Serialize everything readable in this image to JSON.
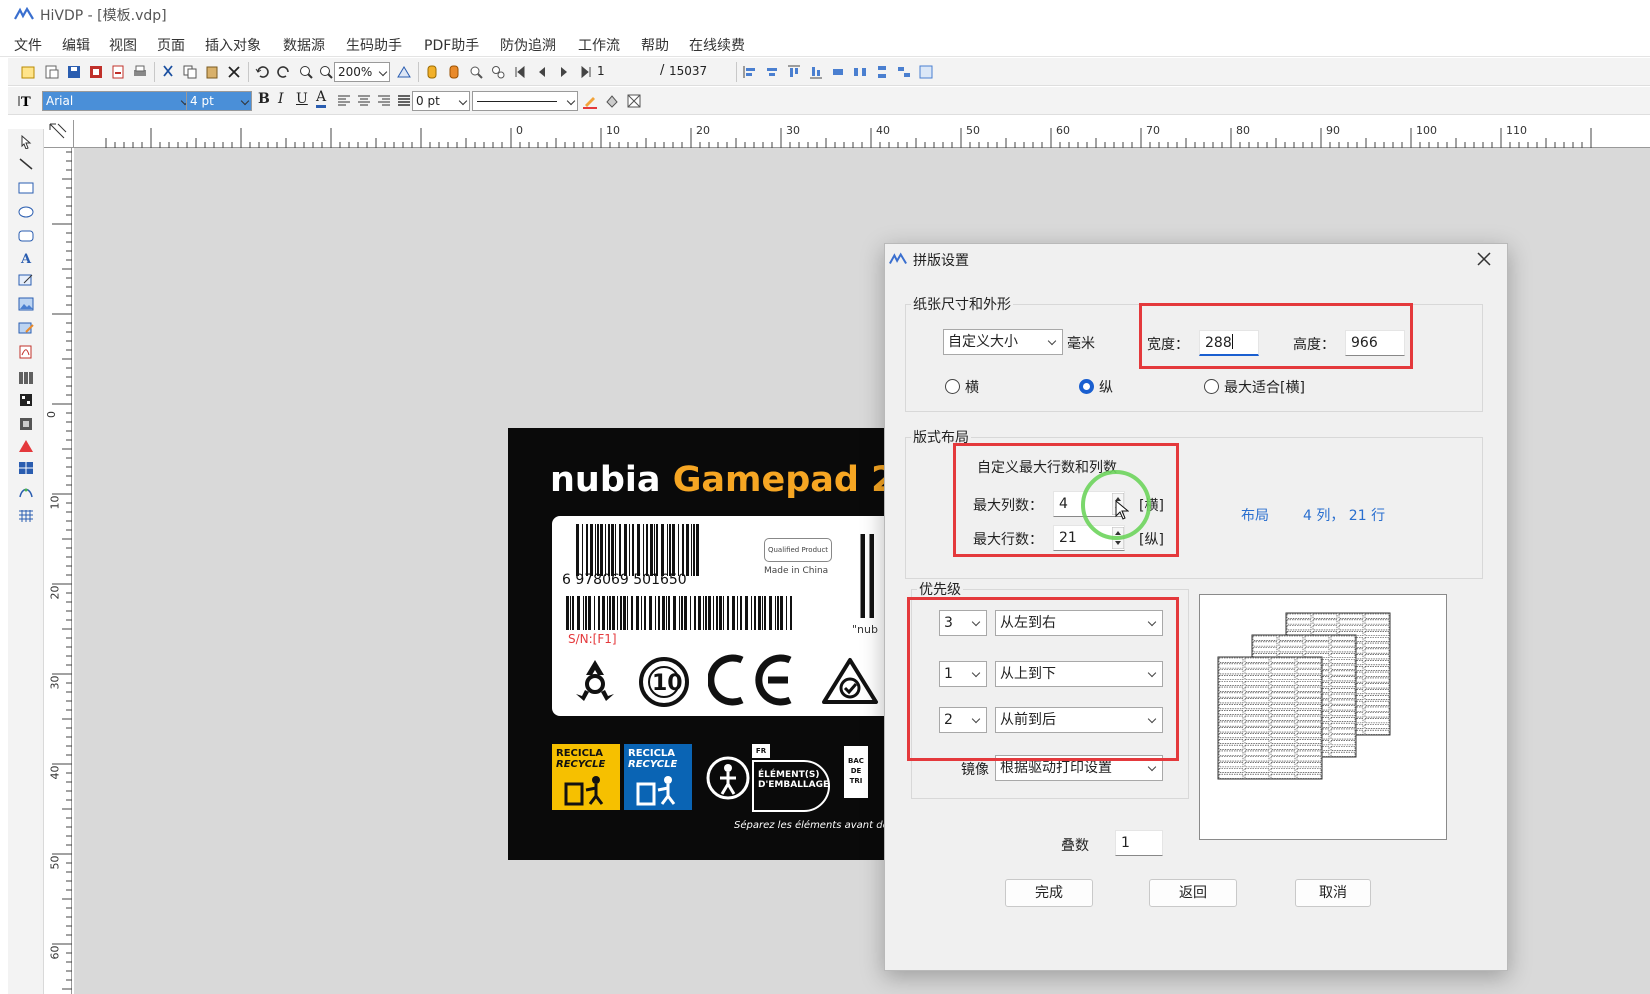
{
  "window": {
    "title": "HiVDP - [模板.vdp]"
  },
  "menu": [
    "文件",
    "编辑",
    "视图",
    "页面",
    "插入对象",
    "数据源",
    "生码助手",
    "PDF助手",
    "防伪追溯",
    "工作流",
    "帮助",
    "在线续费"
  ],
  "toolbar1": {
    "zoom": "200%",
    "page_current": "1",
    "page_separator": "/",
    "page_total": "15037"
  },
  "toolbar2": {
    "font": "Arial",
    "font_size": "4 pt",
    "line_width": "0 pt"
  },
  "ruler": {
    "h_marks": [
      "0",
      "10",
      "20",
      "30",
      "40",
      "50",
      "60",
      "70",
      "80",
      "90",
      "100",
      "110"
    ],
    "v_marks": [
      "0",
      "10",
      "20",
      "30",
      "40",
      "50",
      "60"
    ]
  },
  "label": {
    "brand": "nubia",
    "product": "Gamepad 2",
    "barcode_digits": "6 978069 501650",
    "made_in": "Made in China",
    "qualified": "Qualified Product",
    "sn": "S/N:[F1]",
    "recycle1": [
      "RECICLA",
      "RECYCLE"
    ],
    "recycle2": [
      "RECICLA",
      "RECYCLE"
    ],
    "fr": "FR",
    "element_text": [
      "ÉLÉMENT(S)",
      "D'EMBALLAGE"
    ],
    "bac": [
      "BAC",
      "DE",
      "TRI"
    ],
    "separez": "Séparez les éléments avant de",
    "qr_partial": "\"nub",
    "ten": "10"
  },
  "dialog": {
    "title": "拼版设置",
    "paper_group": "纸张尺寸和外形",
    "paper_size": "自定义大小",
    "unit": "毫米",
    "width_label": "宽度：",
    "width_value": "288",
    "height_label": "高度：",
    "height_value": "966",
    "orient": [
      {
        "label": "横",
        "checked": false
      },
      {
        "label": "纵",
        "checked": true
      },
      {
        "label": "最大适合[横]",
        "checked": false
      }
    ],
    "layout_group": "版式布局",
    "custom_max": "自定义最大行数和列数",
    "max_cols_label": "最大列数：",
    "max_cols": "4",
    "cols_unit": "[横]",
    "max_rows_label": "最大行数：",
    "max_rows": "21",
    "rows_unit": "[纵]",
    "layout_label": "布局",
    "layout_summary": "4 列，  21 行",
    "priority_group": "优先级",
    "priorities": [
      {
        "num": "3",
        "dir": "从左到右"
      },
      {
        "num": "1",
        "dir": "从上到下"
      },
      {
        "num": "2",
        "dir": "从前到后"
      }
    ],
    "mirror_label": "镜像",
    "mirror_value": "根据驱动打印设置",
    "stack_label": "叠数",
    "stack_value": "1",
    "buttons": {
      "done": "完成",
      "back": "返回",
      "cancel": "取消"
    }
  },
  "colors": {
    "highlight": "#e4393c",
    "accent": "#1a5fd0",
    "focus_ring": "#6dd45c",
    "label_bg": "#0a0a0a",
    "yellow": "#f6c000",
    "blue": "#0a64b4"
  }
}
